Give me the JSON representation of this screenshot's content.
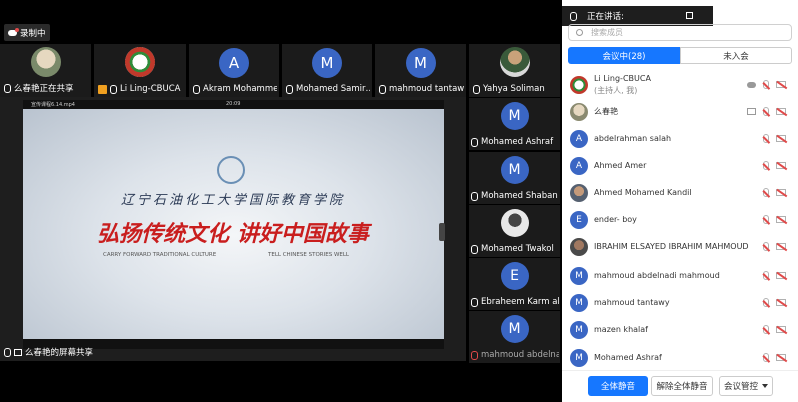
{
  "recording": {
    "label": "录制中"
  },
  "top_strip": [
    {
      "name": "么春艳正在共享",
      "type": "photo"
    },
    {
      "name": "Li Ling-CBUCA",
      "type": "logo"
    },
    {
      "name": "Akram Mohammed",
      "initial": "A"
    },
    {
      "name": "Mohamed Samir…",
      "initial": "M"
    },
    {
      "name": "mahmoud tantawy",
      "initial": "M"
    },
    {
      "name": "Yahya Soliman",
      "type": "photo"
    }
  ],
  "right_tiles": [
    {
      "name": "Mohamed Ashraf",
      "initial": "M"
    },
    {
      "name": "Mohamed Shaban …",
      "initial": "M"
    },
    {
      "name": "Mohamed Twakol",
      "type": "photo"
    },
    {
      "name": "Ebraheem Karm abo …",
      "initial": "E"
    },
    {
      "name": "mahmoud abdelna…",
      "initial": "M"
    }
  ],
  "share": {
    "file_name": "宣传课程6.14.mp4",
    "time": "20:09",
    "calligraphy_top": "辽宁石油化工大学国际教育学院",
    "slogan_red": "弘扬传统文化  讲好中国故事",
    "slogan_en_left": "CARRY FORWARD TRADITIONAL CULTURE",
    "slogan_en_right": "TELL CHINESE STORIES WELL",
    "footer_label": "么春艳的屏幕共享"
  },
  "panel": {
    "speaking_label": "正在讲话:",
    "search_placeholder": "搜索成员",
    "tab_in_meeting": "会议中(28)",
    "tab_not_joined": "未入会",
    "host_name": "Li Ling-CBUCA",
    "host_role": "(主持人, 我)",
    "members": [
      {
        "name": "么春艳",
        "type": "photo"
      },
      {
        "name": "abdelrahman salah",
        "initial": "A"
      },
      {
        "name": "Ahmed Amer",
        "initial": "A"
      },
      {
        "name": "Ahmed Mohamed Kandil",
        "type": "photo"
      },
      {
        "name": "ender- boy",
        "initial": "E"
      },
      {
        "name": "IBRAHIM ELSAYED IBRAHIM MAHMOUD",
        "type": "photo"
      },
      {
        "name": "mahmoud abdelnadi mahmoud",
        "initial": "M"
      },
      {
        "name": "mahmoud tantawy",
        "initial": "M"
      },
      {
        "name": "mazen khalaf",
        "initial": "M"
      },
      {
        "name": "Mohamed Ashraf",
        "initial": "M"
      }
    ],
    "buttons": {
      "mute_all": "全体静音",
      "unmute_all": "解除全体静音",
      "manage": "会议管控"
    }
  },
  "colors": {
    "accent": "#1677ff",
    "avatar": "#3a66c4",
    "muted": "#e04a4a"
  }
}
